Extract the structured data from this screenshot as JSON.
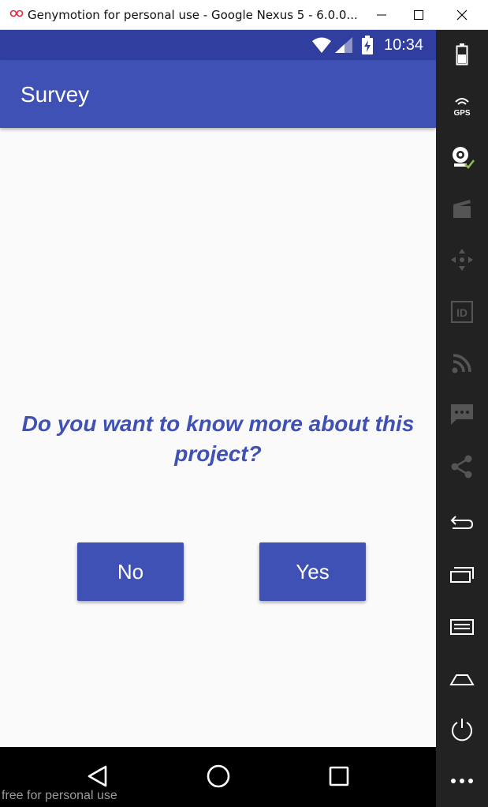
{
  "window": {
    "title": "Genymotion for personal use - Google Nexus 5 - 6.0.0..."
  },
  "status_bar": {
    "time": "10:34"
  },
  "app_bar": {
    "title": "Survey"
  },
  "main": {
    "question": "Do you want to know more about this project?",
    "no_label": "No",
    "yes_label": "Yes"
  },
  "watermark": "free for personal use",
  "sidebar": {
    "gps_label": "GPS",
    "id_label": "ID"
  },
  "colors": {
    "primary": "#3f51b5",
    "primary_dark": "#303f9f",
    "background": "#fafafa",
    "toolbar": "#222222"
  }
}
